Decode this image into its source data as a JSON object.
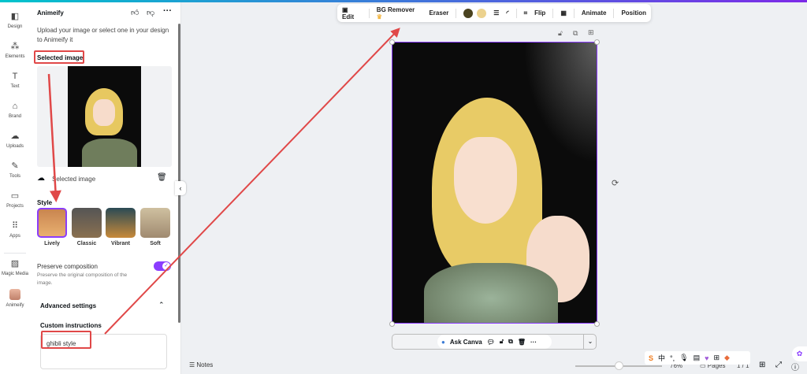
{
  "rail": [
    {
      "label": "Design",
      "icon": "layout-icon"
    },
    {
      "label": "Elements",
      "icon": "shapes-icon"
    },
    {
      "label": "Text",
      "icon": "text-icon"
    },
    {
      "label": "Brand",
      "icon": "brand-icon"
    },
    {
      "label": "Uploads",
      "icon": "upload-cloud-icon"
    },
    {
      "label": "Tools",
      "icon": "pen-icon"
    },
    {
      "label": "Projects",
      "icon": "folder-icon"
    },
    {
      "label": "Apps",
      "icon": "apps-icon"
    },
    {
      "label": "Magic Media",
      "icon": "magic-media-icon"
    },
    {
      "label": "Animeify",
      "icon": "animeify-app-icon"
    }
  ],
  "panel": {
    "title": "Animeify",
    "description": "Upload your image or select one in your design to Animeify it",
    "selected_heading": "Selected image",
    "selected_label": "Selected image",
    "style_heading": "Style",
    "styles": [
      "Lively",
      "Classic",
      "Vibrant",
      "Soft"
    ],
    "selected_style": "Lively",
    "preserve_title": "Preserve composition",
    "preserve_desc": "Preserve the original composition of the image.",
    "preserve_on": true,
    "advanced": "Advanced settings",
    "custom_label": "Custom instructions",
    "custom_value": "ghibli style"
  },
  "toolbar": {
    "edit": "Edit",
    "bg_remover": "BG Remover",
    "eraser": "Eraser",
    "colors": [
      "#4a4320",
      "#ecd28e"
    ],
    "flip": "Flip",
    "animate": "Animate",
    "position": "Position"
  },
  "bottom": {
    "ask": "Ask Canva",
    "notes": "Notes",
    "zoom": "76%",
    "pages": "Pages",
    "page_count": "1 / 1"
  },
  "accent": "#8b3dff",
  "annotation_color": "#e04848"
}
